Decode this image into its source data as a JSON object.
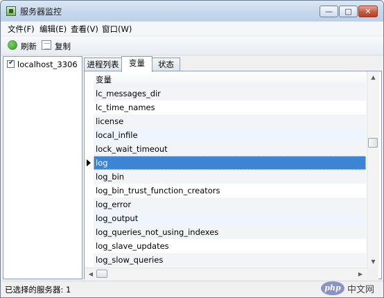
{
  "window": {
    "title": "服务器监控"
  },
  "caption_buttons": {
    "minimize": "—",
    "maximize": "□",
    "close": "✕"
  },
  "menu": {
    "items": [
      "文件(F)",
      "编辑(E)",
      "查看(V)",
      "窗口(W)"
    ]
  },
  "toolbar": {
    "refresh_label": "刷新",
    "copy_label": "复制"
  },
  "servers": [
    {
      "label": "localhost_3306",
      "checked": true,
      "check_glyph": "✔"
    }
  ],
  "tabs": [
    {
      "label": "进程列表",
      "active": false
    },
    {
      "label": "变量",
      "active": true
    },
    {
      "label": "状态",
      "active": false
    }
  ],
  "grid": {
    "column_header": "变量",
    "selected_index": 5,
    "rows": [
      "lc_messages_dir",
      "lc_time_names",
      "license",
      "local_infile",
      "lock_wait_timeout",
      "log",
      "log_bin",
      "log_bin_trust_function_creators",
      "log_error",
      "log_output",
      "log_queries_not_using_indexes",
      "log_slave_updates",
      "log_slow_queries"
    ]
  },
  "scroll_glyphs": {
    "up": "▲",
    "down": "▼",
    "left": "◀",
    "right": "▶"
  },
  "statusbar": {
    "text": "已选择的服务器: 1"
  },
  "watermark": {
    "badge": "php",
    "text": "中文网"
  }
}
